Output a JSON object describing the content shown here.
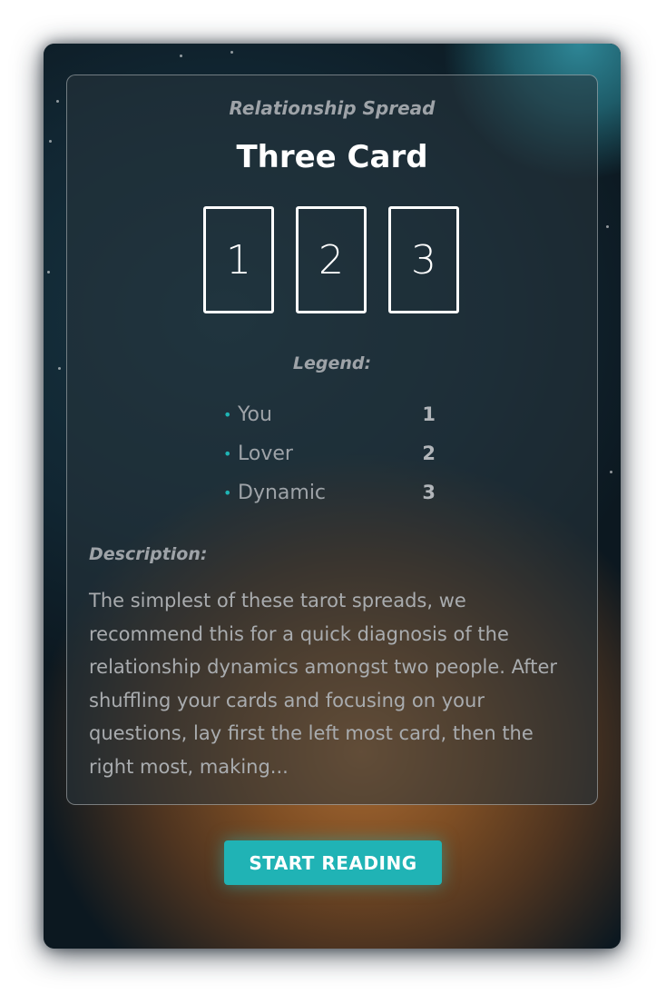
{
  "spread": {
    "subtitle": "Relationship Spread",
    "title": "Three Card",
    "cards": [
      "1",
      "2",
      "3"
    ]
  },
  "legend": {
    "title": "Legend:",
    "items": [
      {
        "label": "You",
        "number": "1"
      },
      {
        "label": "Lover",
        "number": "2"
      },
      {
        "label": "Dynamic",
        "number": "3"
      }
    ]
  },
  "description": {
    "title": "Description:",
    "text": "The simplest of these tarot spreads, we recommend this for a quick diagnosis of the relationship dynamics amongst two people. After shuffling your cards and focusing on your questions, lay first the left most card, then the right most, making..."
  },
  "actions": {
    "start_label": "START READING"
  },
  "colors": {
    "accent": "#20b3b5",
    "background": "#0f1e28",
    "text_muted": "#9ea3a8"
  }
}
